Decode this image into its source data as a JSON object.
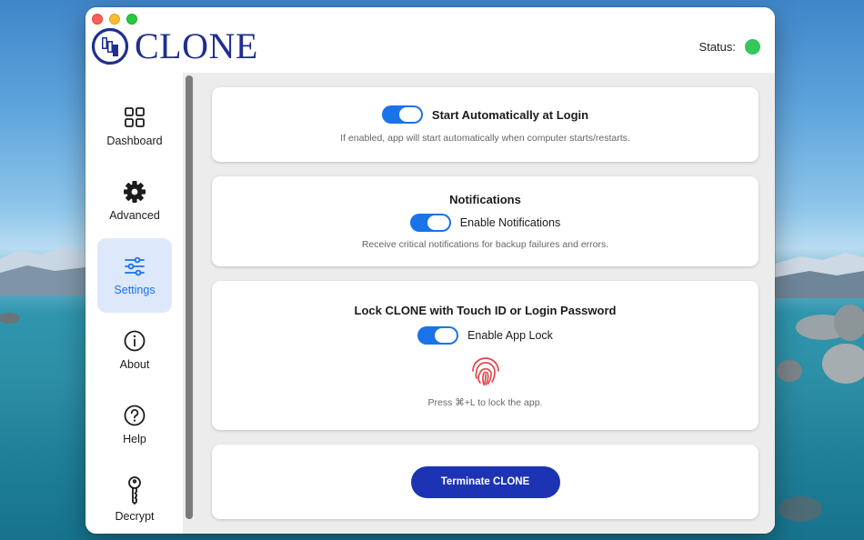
{
  "window": {
    "app_name": "CLONE",
    "status_label": "Status:",
    "status_color": "#34c759"
  },
  "sidebar": {
    "items": [
      {
        "label": "Dashboard",
        "icon": "grid-icon",
        "active": false
      },
      {
        "label": "Advanced",
        "icon": "gear-icon",
        "active": false
      },
      {
        "label": "Settings",
        "icon": "sliders-icon",
        "active": true
      },
      {
        "label": "About",
        "icon": "info-icon",
        "active": false
      },
      {
        "label": "Help",
        "icon": "question-icon",
        "active": false
      },
      {
        "label": "Decrypt",
        "icon": "key-icon",
        "active": false
      }
    ]
  },
  "settings": {
    "auto_start": {
      "label": "Start Automatically at Login",
      "enabled": true,
      "description": "If enabled, app will start automatically when computer starts/restarts."
    },
    "notifications": {
      "title": "Notifications",
      "label": "Enable Notifications",
      "enabled": true,
      "description": "Receive critical notifications for backup failures and errors."
    },
    "app_lock": {
      "title": "Lock CLONE with Touch ID or Login Password",
      "label": "Enable App Lock",
      "enabled": true,
      "icon": "fingerprint-icon",
      "description": "Press ⌘+L to lock the app."
    },
    "terminate": {
      "label": "Terminate CLONE"
    }
  },
  "colors": {
    "accent": "#1a73e8",
    "brand": "#1f2f8f",
    "terminate": "#1c34b4",
    "active_sidebar_bg": "#dde9fb",
    "fingerprint": "#e0484e"
  }
}
